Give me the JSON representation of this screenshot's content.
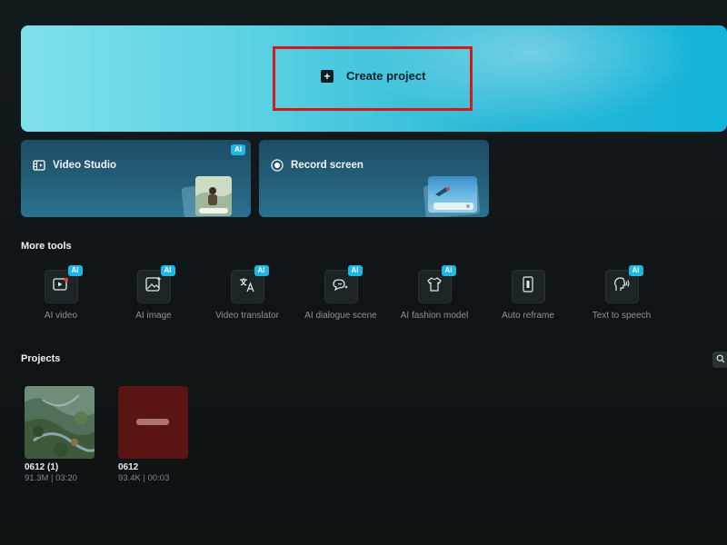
{
  "hero": {
    "create_label": "Create project",
    "icon": "plus-icon"
  },
  "cards": [
    {
      "title": "Video Studio",
      "icon": "film-icon",
      "badge": "AI"
    },
    {
      "title": "Record screen",
      "icon": "record-icon",
      "badge": ""
    }
  ],
  "more_tools": {
    "title": "More tools",
    "items": [
      {
        "label": "AI video",
        "badge": "AI",
        "icon": "ai-video-icon"
      },
      {
        "label": "AI image",
        "badge": "AI",
        "icon": "ai-image-icon"
      },
      {
        "label": "Video translator",
        "badge": "AI",
        "icon": "translate-icon"
      },
      {
        "label": "AI dialogue scene",
        "badge": "AI",
        "icon": "dialogue-icon"
      },
      {
        "label": "AI fashion model",
        "badge": "AI",
        "icon": "shirt-icon"
      },
      {
        "label": "Auto reframe",
        "badge": "",
        "icon": "reframe-icon"
      },
      {
        "label": "Text to speech",
        "badge": "AI",
        "icon": "speech-icon"
      }
    ]
  },
  "projects": {
    "title": "Projects",
    "items": [
      {
        "name": "0612 (1)",
        "meta": "91.3M | 03:20"
      },
      {
        "name": "0612",
        "meta": "93.4K | 00:03"
      }
    ]
  },
  "colors": {
    "accent": "#1fb6e8",
    "highlight": "#d21a1a",
    "hero_start": "#7fe0ea",
    "hero_end": "#14b3d9"
  }
}
